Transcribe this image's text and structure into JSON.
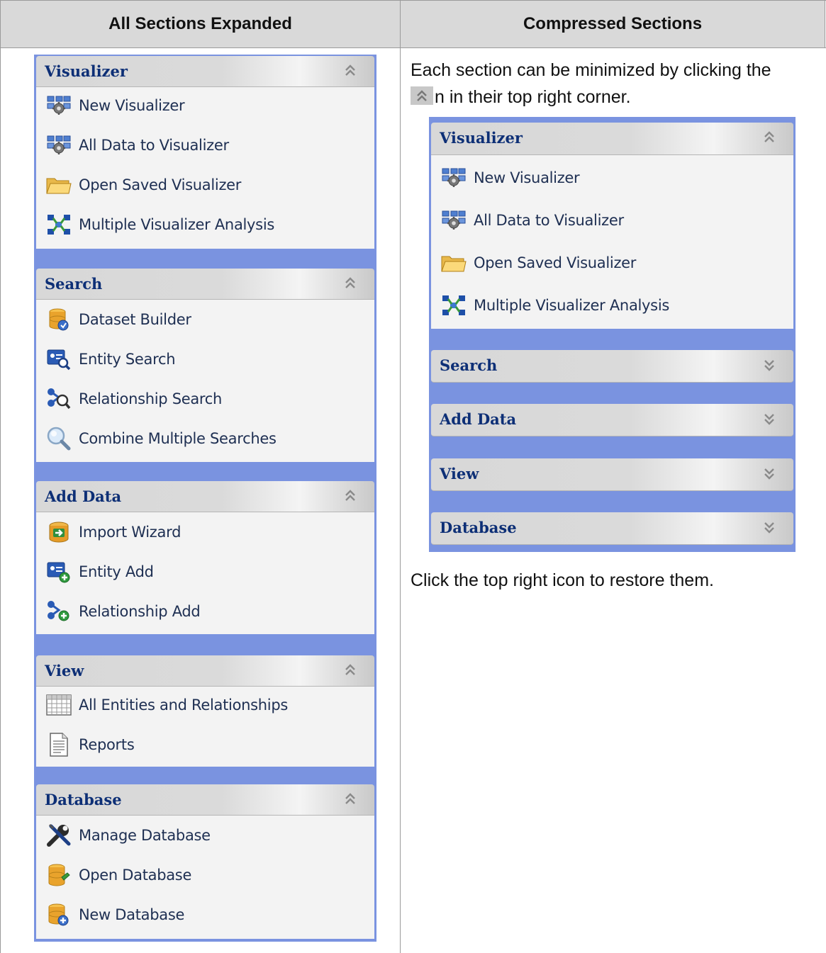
{
  "table": {
    "left_header": "All Sections Expanded",
    "right_header": "Compressed Sections"
  },
  "expanded": {
    "visualizer": {
      "title": "Visualizer",
      "items": [
        "New Visualizer",
        "All Data to Visualizer",
        "Open Saved Visualizer",
        "Multiple Visualizer Analysis"
      ]
    },
    "search": {
      "title": "Search",
      "items": [
        "Dataset Builder",
        "Entity Search",
        "Relationship Search",
        "Combine Multiple Searches"
      ]
    },
    "add_data": {
      "title": "Add Data",
      "items": [
        "Import Wizard",
        "Entity Add",
        "Relationship Add"
      ]
    },
    "view": {
      "title": "View",
      "items": [
        "All Entities and Relationships",
        "Reports"
      ]
    },
    "database": {
      "title": "Database",
      "items": [
        "Manage Database",
        "Open Database",
        "New Database"
      ]
    }
  },
  "compressed": {
    "intro_line1": "Each section can be minimized by clicking the",
    "intro_line2": "n in their top right corner.",
    "visualizer": {
      "title": "Visualizer",
      "items": [
        "New Visualizer",
        "All Data to Visualizer",
        "Open Saved Visualizer",
        "Multiple Visualizer Analysis"
      ]
    },
    "collapsed_titles": [
      "Search",
      "Add Data",
      "View",
      "Database"
    ],
    "outro": "Click the top right icon to restore them."
  },
  "icons": {
    "expand_chevron": "double-chevron-up-icon",
    "collapse_chevron": "double-chevron-down-icon"
  },
  "colors": {
    "panel_blue": "#7a93e0",
    "title_navy": "#0d2f76",
    "header_gray": "#d9d9d9"
  }
}
